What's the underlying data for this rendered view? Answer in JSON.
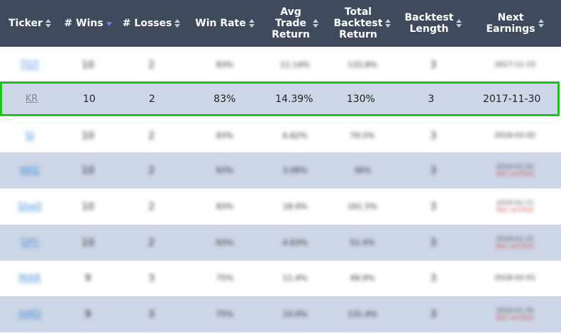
{
  "headers": [
    {
      "label": "Ticker",
      "sort": "both"
    },
    {
      "label": "# Wins",
      "sort": "desc"
    },
    {
      "label": "# Losses",
      "sort": "both"
    },
    {
      "label": "Win Rate",
      "sort": "both"
    },
    {
      "label": "Avg\nTrade\nReturn",
      "sort": "both"
    },
    {
      "label": "Total\nBacktest\nReturn",
      "sort": "both"
    },
    {
      "label": "Backtest\nLength",
      "sort": "both"
    },
    {
      "label": "Next\nEarnings",
      "sort": "both"
    }
  ],
  "rows": [
    {
      "ticker": "TGT",
      "wins": "10",
      "losses": "2",
      "win_rate": "83%",
      "avg": "11.14%",
      "total": "133.8%",
      "length": "3",
      "earnings": "2017-11-15",
      "earnings_note": ""
    },
    {
      "ticker": "KR",
      "wins": "10",
      "losses": "2",
      "win_rate": "83%",
      "avg": "14.39%",
      "total": "130%",
      "length": "3",
      "earnings": "2017-11-30",
      "earnings_note": ""
    },
    {
      "ticker": "SJ",
      "wins": "10",
      "losses": "2",
      "win_rate": "83%",
      "avg": "6.62%",
      "total": "79.5%",
      "length": "3",
      "earnings": "2018-03-02",
      "earnings_note": ""
    },
    {
      "ticker": "NKE",
      "wins": "10",
      "losses": "2",
      "win_rate": "83%",
      "avg": "3.08%",
      "total": "36%",
      "length": "3",
      "earnings": "2018-03-20",
      "earnings_note": "Not verified"
    },
    {
      "ticker": "Shell",
      "wins": "10",
      "losses": "2",
      "win_rate": "83%",
      "avg": "18.9%",
      "total": "161.5%",
      "length": "3",
      "earnings": "2018-02-13",
      "earnings_note": "Not verified"
    },
    {
      "ticker": "SPY",
      "wins": "10",
      "losses": "2",
      "win_rate": "83%",
      "avg": "4.63%",
      "total": "51.4%",
      "length": "3",
      "earnings": "2018-02-15",
      "earnings_note": "Not verified"
    },
    {
      "ticker": "MAR",
      "wins": "9",
      "losses": "3",
      "win_rate": "75%",
      "avg": "11.4%",
      "total": "49.9%",
      "length": "3",
      "earnings": "2018-02-01",
      "earnings_note": ""
    },
    {
      "ticker": "AMD",
      "wins": "9",
      "losses": "3",
      "win_rate": "75%",
      "avg": "10.9%",
      "total": "131.4%",
      "length": "3",
      "earnings": "2018-01-30",
      "earnings_note": "Not verified"
    }
  ]
}
